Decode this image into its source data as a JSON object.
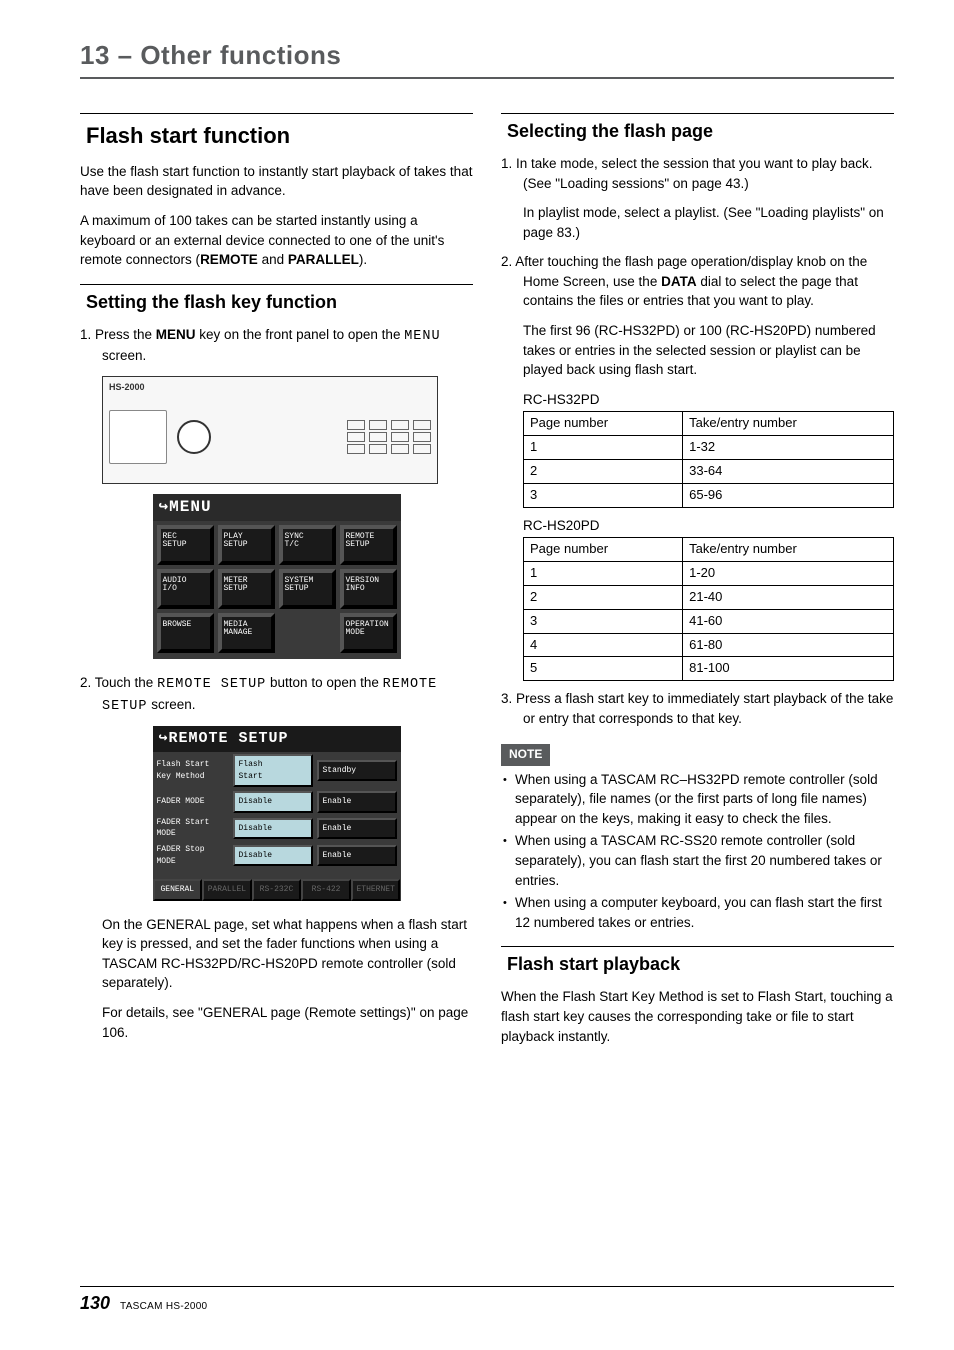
{
  "chapter": "13 – Other functions",
  "left": {
    "h2": "Flash start function",
    "intro1": "Use the flash start function to instantly start playback of takes that have been designated in advance.",
    "intro2_pre": "A maximum of 100 takes can be started instantly using a keyboard or an external device connected to one of the unit's remote connectors (",
    "intro2_bold1": "REMOTE",
    "intro2_mid": " and ",
    "intro2_bold2": "PARALLEL",
    "intro2_post": ").",
    "h3": "Setting the flash key function",
    "step1_pre": "1.  Press the ",
    "step1_bold": "MENU",
    "step1_mid": " key on the front panel to open the ",
    "step1_mono": "MENU",
    "step1_post": " screen.",
    "device_label": "HS-2000",
    "menu": {
      "title": "MENU",
      "items": [
        "REC\nSETUP",
        "PLAY\nSETUP",
        "SYNC\nT/C",
        "REMOTE\nSETUP",
        "AUDIO\nI/O",
        "METER\nSETUP",
        "SYSTEM\nSETUP",
        "VERSION\nINFO",
        "BROWSE",
        "MEDIA\nMANAGE",
        "",
        "OPERATION\nMODE"
      ]
    },
    "step2_pre": "2.  Touch the ",
    "step2_mono1": "REMOTE SETUP",
    "step2_mid": " button to open the ",
    "step2_mono2": "REMOTE SETUP",
    "step2_post": " screen.",
    "remote_setup": {
      "title": "REMOTE SETUP",
      "rows": [
        {
          "label": "Flash Start\nKey Method",
          "opts": [
            "Flash\nStart",
            "Standby"
          ],
          "active": 0
        },
        {
          "label": "FADER MODE",
          "opts": [
            "Disable",
            "Enable"
          ],
          "active": 0
        },
        {
          "label": "FADER Start\nMODE",
          "opts": [
            "Disable",
            "Enable"
          ],
          "active": 0
        },
        {
          "label": "FADER Stop\nMODE",
          "opts": [
            "Disable",
            "Enable"
          ],
          "active": 0
        }
      ],
      "tabs": [
        "GENERAL",
        "PARALLEL",
        "RS-232C",
        "RS-422",
        "ETHERNET"
      ]
    },
    "para_after1": "On the GENERAL page, set what happens when a flash start key is pressed, and set the fader functions when using a TASCAM RC-HS32PD/RC-HS20PD remote controller (sold separately).",
    "para_after2": "For details, see \"GENERAL page (Remote settings)\" on page 106."
  },
  "right": {
    "h3a": "Selecting the flash page",
    "step1a": "1.  In take mode, select the session that you want to play back. (See \"Loading sessions\" on page 43.)",
    "step1b": "In playlist mode, select a playlist. (See \"Loading playlists\" on page 83.)",
    "step2a_pre": "2.  After touching the flash page operation/display knob on the Home Screen, use the ",
    "step2a_bold": "DATA",
    "step2a_post": " dial to select the page that contains the files or entries that you want to play.",
    "step2b": "The first 96 (RC-HS32PD) or 100 (RC-HS20PD) numbered takes or entries in the selected session or playlist can be played back using flash start.",
    "table1": {
      "caption": "RC-HS32PD",
      "headers": [
        "Page number",
        "Take/entry number"
      ],
      "rows": [
        [
          "1",
          "1-32"
        ],
        [
          "2",
          "33-64"
        ],
        [
          "3",
          "65-96"
        ]
      ]
    },
    "table2": {
      "caption": "RC-HS20PD",
      "headers": [
        "Page number",
        "Take/entry number"
      ],
      "rows": [
        [
          "1",
          "1-20"
        ],
        [
          "2",
          "21-40"
        ],
        [
          "3",
          "41-60"
        ],
        [
          "4",
          "61-80"
        ],
        [
          "5",
          "81-100"
        ]
      ]
    },
    "step3": "3.  Press a flash start key to immediately start playback of the take or entry that corresponds to that key.",
    "note_label": "NOTE",
    "notes": [
      "When using a TASCAM RC–HS32PD remote controller (sold separately), file names (or the first parts of long file names) appear on the keys, making it easy to check the files.",
      "When using a TASCAM RC-SS20 remote controller (sold separately), you can flash start the first 20 numbered takes or entries.",
      "When using a computer keyboard, you can flash start the first 12 numbered takes or entries."
    ],
    "h3b": "Flash start playback",
    "playback_para": "When the Flash Start Key Method is set to Flash Start, touching a flash start key causes the corresponding take or file to start playback instantly."
  },
  "footer": {
    "page": "130",
    "model": "TASCAM  HS-2000"
  }
}
